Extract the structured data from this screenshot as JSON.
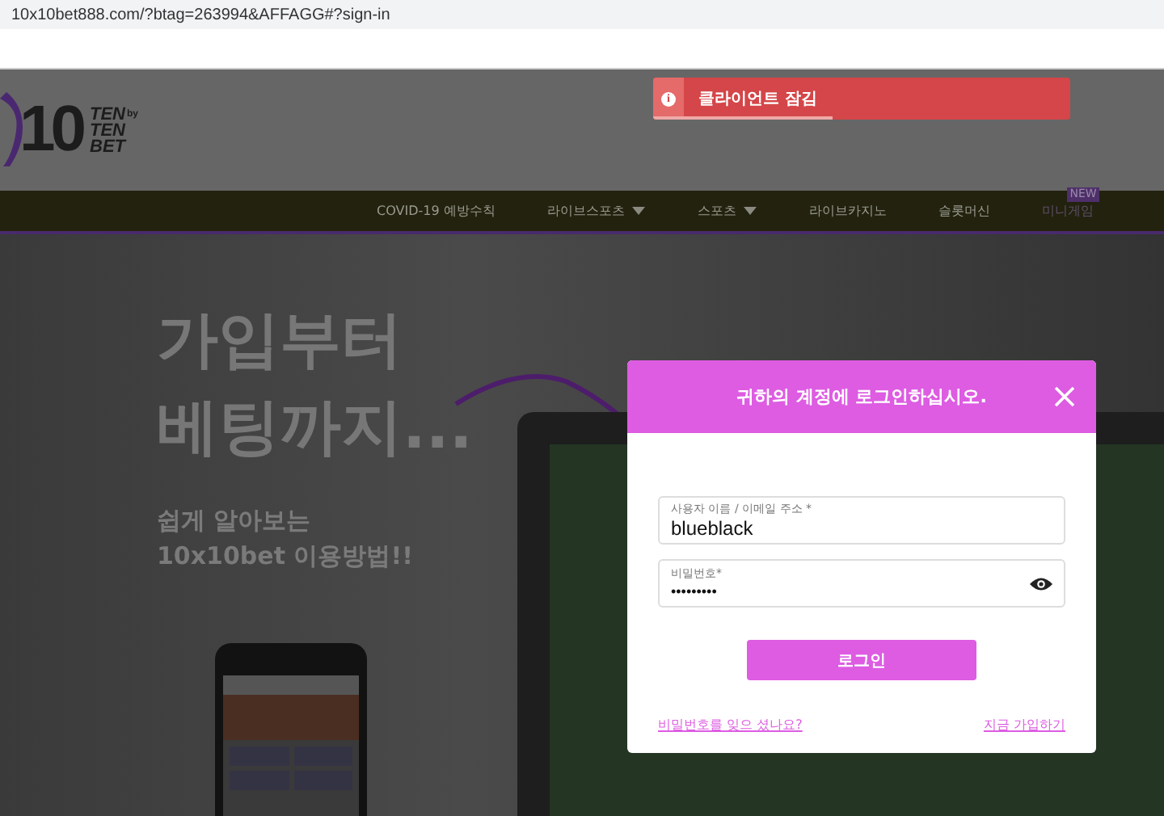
{
  "address_bar": {
    "url": "10x10bet888.com/?btag=263994&AFFAGG#?sign-in"
  },
  "logo": {
    "number": "10",
    "words": [
      "TEN",
      "TEN",
      "BET"
    ],
    "by": "by"
  },
  "toast": {
    "message": "클라이언트 잠김",
    "icon": "i",
    "level": 0.43
  },
  "nav": [
    {
      "label": "COVID-19 예방수칙",
      "dropdown": false
    },
    {
      "label": "라이브스포츠",
      "dropdown": true
    },
    {
      "label": "스포츠",
      "dropdown": true
    },
    {
      "label": "라이브카지노",
      "dropdown": false
    },
    {
      "label": "슬롯머신",
      "dropdown": false
    },
    {
      "label": "미니게임",
      "dropdown": false,
      "badge": "NEW"
    }
  ],
  "hero": {
    "headline": [
      "가입부터",
      "베팅까지..."
    ],
    "subtitle": [
      "쉽게 알아보는",
      "10x10bet 이용방법!!"
    ]
  },
  "login": {
    "title": "귀하의 계정에 로그인하십시오.",
    "username": {
      "label": "사용자 이름 / 이메일 주소 *",
      "value": "blueblack"
    },
    "password": {
      "label": "비밀번호*",
      "value": "•••••••••"
    },
    "submit": "로그인",
    "forgot": "비밀번호를 잊으 셨나요?",
    "register": "지금 가입하기"
  }
}
